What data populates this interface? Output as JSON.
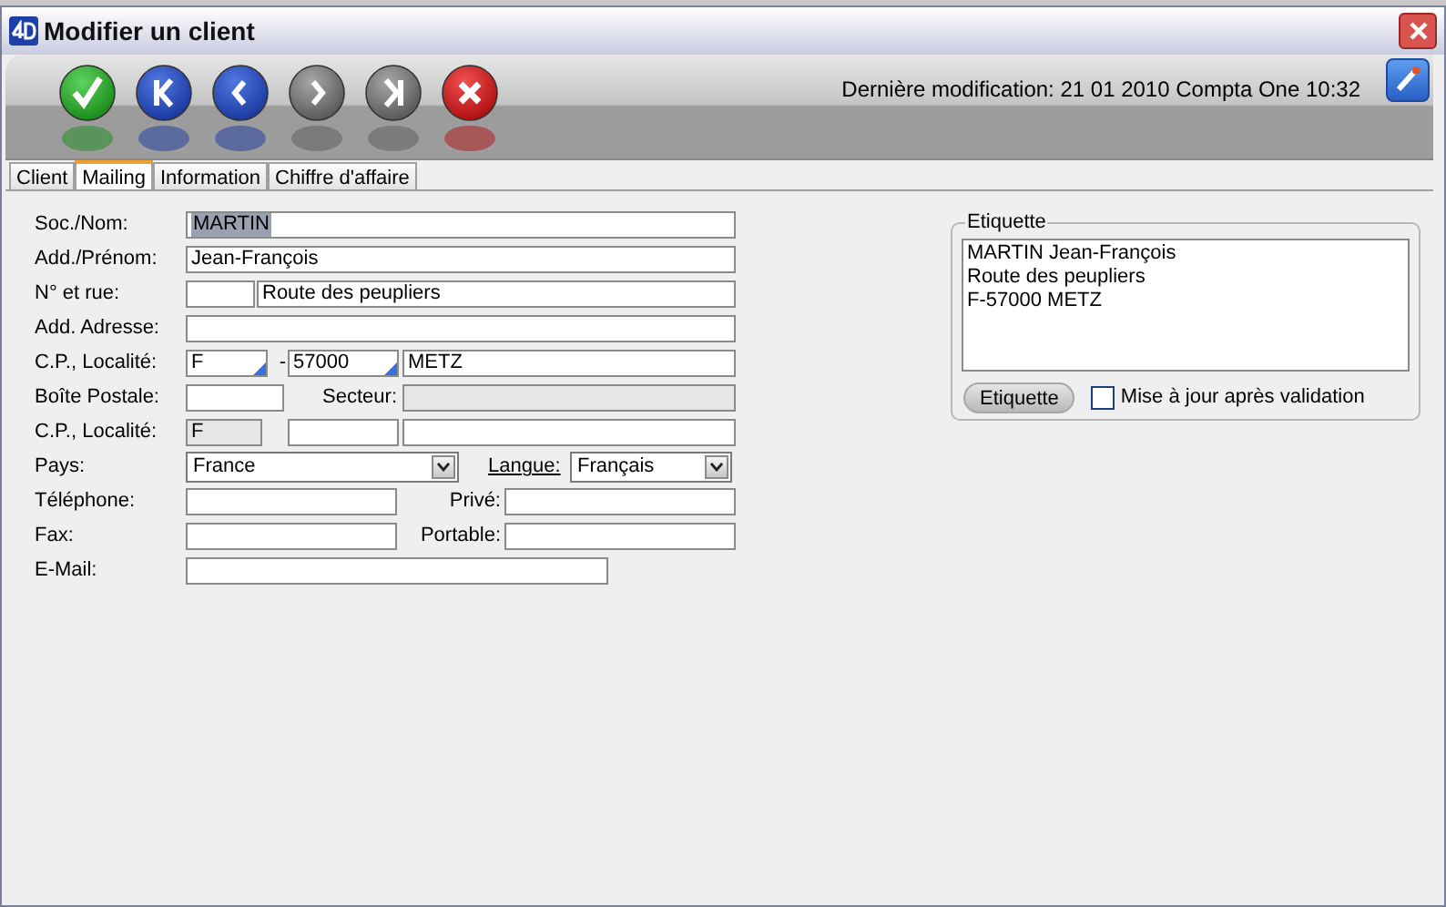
{
  "window": {
    "title": "Modifier un client"
  },
  "toolbar": {
    "buttons": [
      {
        "kind": "confirm",
        "disabled": false
      },
      {
        "kind": "first",
        "disabled": false
      },
      {
        "kind": "previous",
        "disabled": false
      },
      {
        "kind": "next",
        "disabled": true
      },
      {
        "kind": "last",
        "disabled": true
      },
      {
        "kind": "cancel",
        "disabled": false
      }
    ],
    "last_modified": "Dernière modification: 21 01 2010 Compta One 10:32"
  },
  "tabs": [
    {
      "label": "Client",
      "selected": false
    },
    {
      "label": "Mailing",
      "selected": true
    },
    {
      "label": "Information",
      "selected": false
    },
    {
      "label": "Chiffre d'affaire",
      "selected": false
    }
  ],
  "form": {
    "rows": [
      {
        "label": "Soc./Nom:",
        "fields": [
          {
            "kind": "text",
            "value": "MARTIN",
            "highlighted": true,
            "disabled": false,
            "lookup": false
          }
        ]
      },
      {
        "label": "Add./Prénom:",
        "fields": [
          {
            "kind": "text",
            "value": "Jean-François",
            "highlighted": false,
            "disabled": false,
            "lookup": false
          }
        ]
      },
      {
        "label": "N° et rue:",
        "fields": [
          {
            "kind": "text",
            "disabled": false,
            "lookup": false
          },
          {
            "kind": "text",
            "value": "Route des peupliers",
            "highlighted": false,
            "disabled": false,
            "lookup": false
          }
        ]
      },
      {
        "label": "Add. Adresse:",
        "fields": [
          {
            "kind": "text",
            "disabled": false,
            "lookup": false
          }
        ]
      },
      {
        "label": "C.P., Localité:",
        "fields": [
          {
            "kind": "text",
            "value": "F",
            "highlighted": false,
            "disabled": false,
            "lookup": true
          },
          {
            "kind": "label",
            "text": "-",
            "link": false
          },
          {
            "kind": "text",
            "value": "57000",
            "highlighted": false,
            "disabled": false,
            "lookup": true
          },
          {
            "kind": "text",
            "value": "METZ",
            "highlighted": false,
            "disabled": false,
            "lookup": false
          }
        ]
      },
      {
        "label": "Boîte Postale:",
        "fields": [
          {
            "kind": "text",
            "disabled": false,
            "lookup": false
          },
          {
            "kind": "label",
            "text": "Secteur:",
            "link": false
          },
          {
            "kind": "text",
            "disabled": true,
            "lookup": false
          }
        ]
      },
      {
        "label": "C.P., Localité:",
        "fields": [
          {
            "kind": "text",
            "value": "F",
            "highlighted": false,
            "disabled": true,
            "lookup": false
          },
          {
            "kind": "text",
            "disabled": false,
            "lookup": false
          },
          {
            "kind": "text",
            "disabled": false,
            "lookup": false
          }
        ]
      },
      {
        "label": "Pays:",
        "fields": [
          {
            "kind": "select",
            "value": "France"
          },
          {
            "kind": "label",
            "text": "Langue:",
            "link": true
          },
          {
            "kind": "select",
            "value": "Français"
          }
        ]
      },
      {
        "label": "Téléphone:",
        "fields": [
          {
            "kind": "text",
            "disabled": false,
            "lookup": false
          },
          {
            "kind": "label",
            "text": "Privé:",
            "link": false
          },
          {
            "kind": "text",
            "disabled": false,
            "lookup": false
          }
        ]
      },
      {
        "label": "Fax:",
        "fields": [
          {
            "kind": "text",
            "disabled": false,
            "lookup": false
          },
          {
            "kind": "label",
            "text": "Portable:",
            "link": false
          },
          {
            "kind": "text",
            "disabled": false,
            "lookup": false
          }
        ]
      },
      {
        "label": "E-Mail:",
        "fields": [
          {
            "kind": "text",
            "disabled": false,
            "lookup": false
          }
        ]
      }
    ]
  },
  "label_panel": {
    "title": "Etiquette",
    "lines": [
      "MARTIN Jean-François",
      "Route des peupliers",
      "F-57000 METZ"
    ],
    "button": "Etiquette",
    "checkbox": {
      "label": "Mise à jour après validation",
      "checked": false
    }
  }
}
